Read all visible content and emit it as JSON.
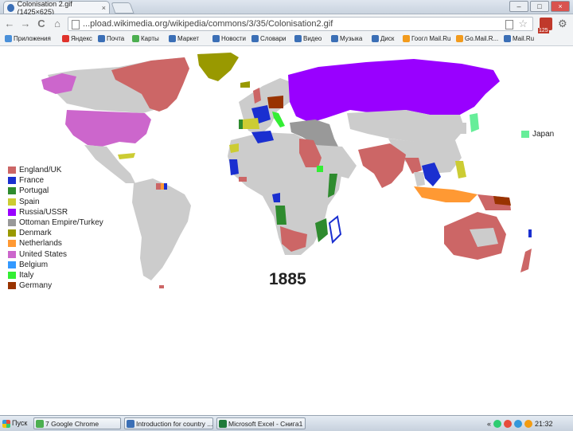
{
  "browser": {
    "tab_title": "Colonisation 2.gif (1425×625)",
    "tab_close": "×",
    "window_controls": {
      "minimize": "–",
      "maximize": "□",
      "close": "×"
    },
    "nav": {
      "back": "←",
      "forward": "→",
      "reload": "C",
      "home": "⌂"
    },
    "url": "...pload.wikimedia.org/wikipedia/commons/3/35/Colonisation2.gif",
    "star": "☆",
    "ext_badge": "125",
    "wrench": "⚙"
  },
  "bookmarks": [
    {
      "label": "Приложения",
      "icon": "apps-icon",
      "color": "#4a90d9"
    },
    {
      "label": "Яндекс",
      "icon": "yandex-icon",
      "color": "#e0332c"
    },
    {
      "label": "Почта",
      "icon": "mail-icon",
      "color": "#3b6fb6"
    },
    {
      "label": "Карты",
      "icon": "maps-icon",
      "color": "#4caf50"
    },
    {
      "label": "Маркет",
      "icon": "market-icon",
      "color": "#3b6fb6"
    },
    {
      "label": "Новости",
      "icon": "news-icon",
      "color": "#3b6fb6"
    },
    {
      "label": "Словари",
      "icon": "dict-icon",
      "color": "#3b6fb6"
    },
    {
      "label": "Видео",
      "icon": "video-icon",
      "color": "#3b6fb6"
    },
    {
      "label": "Музыка",
      "icon": "music-icon",
      "color": "#3b6fb6"
    },
    {
      "label": "Диск",
      "icon": "disk-icon",
      "color": "#3b6fb6"
    },
    {
      "label": "Гоогл Mail.Ru",
      "icon": "mailru-icon",
      "color": "#f29b1d"
    },
    {
      "label": "Go.Mail.R...",
      "icon": "gomail-icon",
      "color": "#f29b1d"
    },
    {
      "label": "Mail.Ru",
      "icon": "mailru2-icon",
      "color": "#3b6fb6"
    }
  ],
  "map": {
    "colors": {
      "ocean": "#ffffff",
      "land": "#cccccc",
      "england": "#cc6666",
      "france": "#1a2fd0",
      "portugal": "#2e8b2e",
      "spain": "#cccc33",
      "russia": "#9900ff",
      "ottoman": "#999999",
      "denmark": "#999900",
      "netherlands": "#ff9933",
      "usa": "#cc66cc",
      "belgium": "#3399ff",
      "italy": "#33ee33",
      "germany": "#993300",
      "japan": "#66ee99"
    },
    "legend": [
      {
        "label": "England/UK",
        "color": "#cc6666"
      },
      {
        "label": "France",
        "color": "#1a2fd0"
      },
      {
        "label": "Portugal",
        "color": "#2e8b2e"
      },
      {
        "label": "Spain",
        "color": "#cccc33"
      },
      {
        "label": "Russia/USSR",
        "color": "#9900ff"
      },
      {
        "label": "Ottoman Empire/Turkey",
        "color": "#999999"
      },
      {
        "label": "Denmark",
        "color": "#999900"
      },
      {
        "label": "Netherlands",
        "color": "#ff9933"
      },
      {
        "label": "United States",
        "color": "#cc66cc"
      },
      {
        "label": "Belgium",
        "color": "#3399ff"
      },
      {
        "label": "Italy",
        "color": "#33ee33"
      },
      {
        "label": "Germany",
        "color": "#993300"
      }
    ],
    "japan_label": "Japan",
    "year": "1885"
  },
  "taskbar": {
    "start": "Пуск",
    "tasks": [
      {
        "label": "7 Google Chrome",
        "color": "#4caf50"
      },
      {
        "label": "Introduction for country ...",
        "color": "#3b6fb6"
      },
      {
        "label": "Microsoft Excel - Cнигa1",
        "color": "#1f7a3a"
      }
    ],
    "clock": "21:32"
  }
}
